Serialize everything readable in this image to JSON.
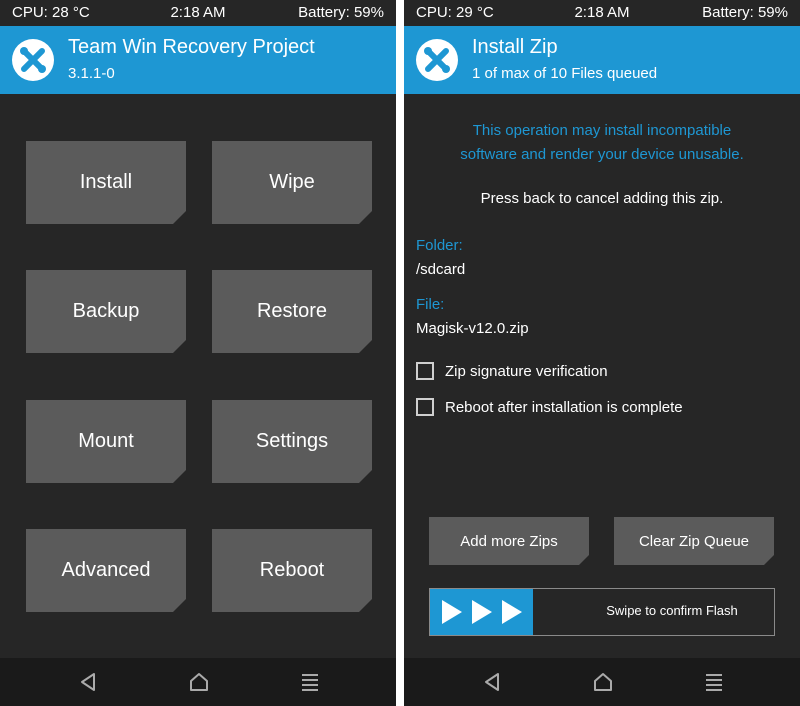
{
  "left": {
    "status": {
      "cpu": "CPU: 28 °C",
      "time": "2:18 AM",
      "battery": "Battery: 59%"
    },
    "header": {
      "title": "Team Win Recovery Project",
      "subtitle": "3.1.1-0",
      "logo_icon": "twrp-logo-icon"
    },
    "menu": [
      "Install",
      "Wipe",
      "Backup",
      "Restore",
      "Mount",
      "Settings",
      "Advanced",
      "Reboot"
    ]
  },
  "right": {
    "status": {
      "cpu": "CPU: 29 °C",
      "time": "2:18 AM",
      "battery": "Battery: 59%"
    },
    "header": {
      "title": "Install Zip",
      "subtitle": "1 of max of 10 Files queued",
      "logo_icon": "twrp-logo-icon"
    },
    "warning_line1": "This operation may install incompatible",
    "warning_line2": "software and render your device unusable.",
    "cancel_hint": "Press back to cancel adding this zip.",
    "folder_label": "Folder:",
    "folder_value": "/sdcard",
    "file_label": "File:",
    "file_value": "Magisk-v12.0.zip",
    "options": [
      {
        "label": "Zip signature verification",
        "checked": false
      },
      {
        "label": "Reboot after installation is complete",
        "checked": false
      }
    ],
    "add_more_label": "Add more Zips",
    "clear_queue_label": "Clear Zip Queue",
    "swipe_label": "Swipe to confirm Flash",
    "swipe_progress": 0.3
  },
  "nav": {
    "back_icon": "back-icon",
    "home_icon": "home-icon",
    "menu_icon": "menu-icon"
  },
  "colors": {
    "accent": "#1e97d3",
    "background": "#262626",
    "tile": "#5b5b5b",
    "navbar": "#1a1a1a"
  }
}
